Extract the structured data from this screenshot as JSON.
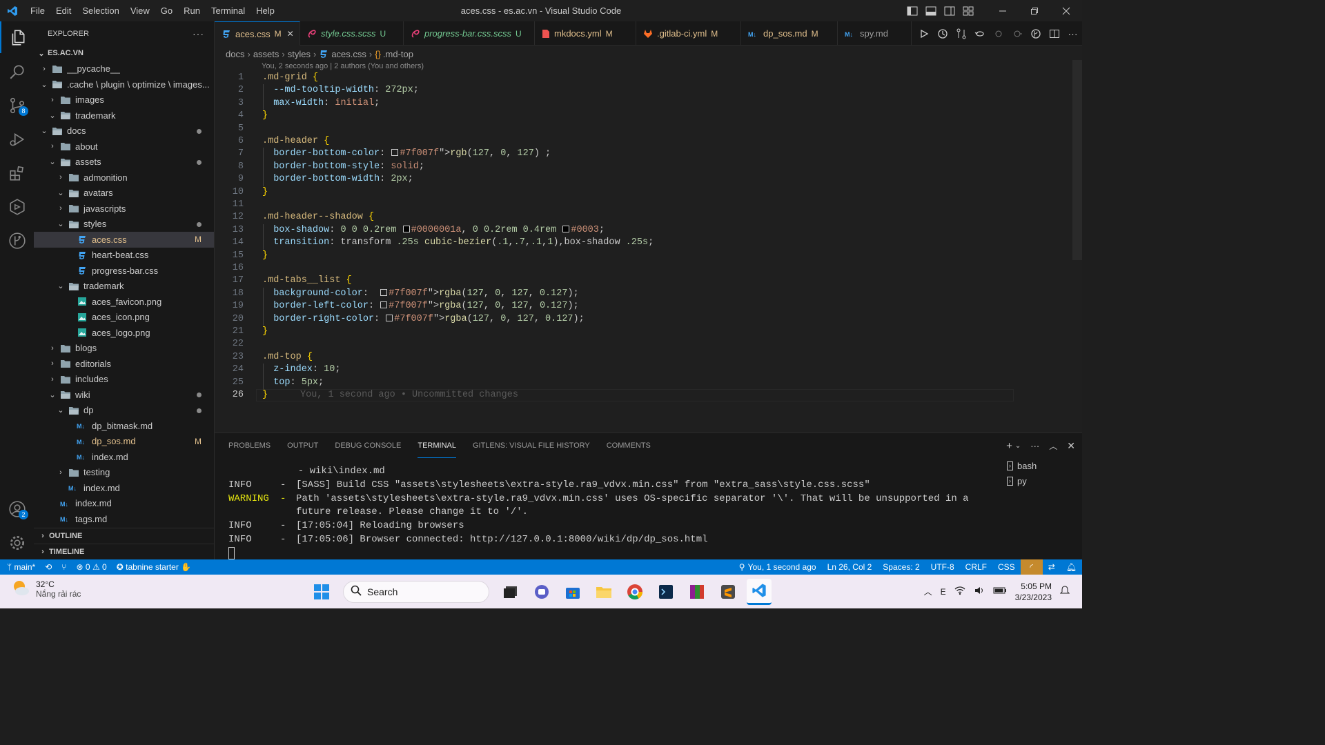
{
  "window": {
    "title": "aces.css - es.ac.vn - Visual Studio Code"
  },
  "menu": [
    "File",
    "Edit",
    "Selection",
    "View",
    "Go",
    "Run",
    "Terminal",
    "Help"
  ],
  "activity_bar": {
    "source_control_badge": "8",
    "accounts_badge": "2"
  },
  "explorer": {
    "header": "EXPLORER",
    "root": "ES.AC.VN",
    "tree": [
      {
        "label": "__pycache__",
        "depth": 1,
        "type": "folder",
        "open": false,
        "status": ""
      },
      {
        "label": ".cache \\ plugin \\ optimize \\ images...",
        "depth": 1,
        "type": "folder",
        "open": true,
        "status": ""
      },
      {
        "label": "images",
        "depth": 2,
        "type": "folder",
        "open": false,
        "status": ""
      },
      {
        "label": "trademark",
        "depth": 2,
        "type": "folder",
        "open": true,
        "status": ""
      },
      {
        "label": "docs",
        "depth": 1,
        "type": "folder",
        "open": true,
        "status": "dot"
      },
      {
        "label": "about",
        "depth": 2,
        "type": "folder",
        "open": false,
        "status": ""
      },
      {
        "label": "assets",
        "depth": 2,
        "type": "folder",
        "open": true,
        "status": "dot"
      },
      {
        "label": "admonition",
        "depth": 3,
        "type": "folder",
        "open": false,
        "status": ""
      },
      {
        "label": "avatars",
        "depth": 3,
        "type": "folder",
        "open": true,
        "status": ""
      },
      {
        "label": "javascripts",
        "depth": 3,
        "type": "folder",
        "open": false,
        "status": ""
      },
      {
        "label": "styles",
        "depth": 3,
        "type": "folder",
        "open": true,
        "status": "dot"
      },
      {
        "label": "aces.css",
        "depth": 4,
        "type": "css",
        "open": false,
        "status": "M",
        "selected": true
      },
      {
        "label": "heart-beat.css",
        "depth": 4,
        "type": "css",
        "open": false,
        "status": ""
      },
      {
        "label": "progress-bar.css",
        "depth": 4,
        "type": "css",
        "open": false,
        "status": ""
      },
      {
        "label": "trademark",
        "depth": 3,
        "type": "folder",
        "open": true,
        "status": ""
      },
      {
        "label": "aces_favicon.png",
        "depth": 4,
        "type": "png",
        "open": false,
        "status": ""
      },
      {
        "label": "aces_icon.png",
        "depth": 4,
        "type": "png",
        "open": false,
        "status": ""
      },
      {
        "label": "aces_logo.png",
        "depth": 4,
        "type": "png",
        "open": false,
        "status": ""
      },
      {
        "label": "blogs",
        "depth": 2,
        "type": "folder",
        "open": false,
        "status": ""
      },
      {
        "label": "editorials",
        "depth": 2,
        "type": "folder",
        "open": false,
        "status": ""
      },
      {
        "label": "includes",
        "depth": 2,
        "type": "folder",
        "open": false,
        "status": ""
      },
      {
        "label": "wiki",
        "depth": 2,
        "type": "folder",
        "open": true,
        "status": "dot"
      },
      {
        "label": "dp",
        "depth": 3,
        "type": "folder",
        "open": true,
        "status": "dot"
      },
      {
        "label": "dp_bitmask.md",
        "depth": 4,
        "type": "md",
        "open": false,
        "status": ""
      },
      {
        "label": "dp_sos.md",
        "depth": 4,
        "type": "md",
        "open": false,
        "status": "M"
      },
      {
        "label": "index.md",
        "depth": 4,
        "type": "md",
        "open": false,
        "status": ""
      },
      {
        "label": "testing",
        "depth": 3,
        "type": "folder",
        "open": false,
        "status": ""
      },
      {
        "label": "index.md",
        "depth": 3,
        "type": "md",
        "open": false,
        "status": ""
      },
      {
        "label": "index.md",
        "depth": 2,
        "type": "md",
        "open": false,
        "status": ""
      },
      {
        "label": "tags.md",
        "depth": 2,
        "type": "md",
        "open": false,
        "status": ""
      }
    ],
    "outline": "OUTLINE",
    "timeline": "TIMELINE"
  },
  "tabs": [
    {
      "label": "aces.css",
      "status": "M",
      "type": "css",
      "active": true
    },
    {
      "label": "style.css.scss",
      "status": "U",
      "type": "scss"
    },
    {
      "label": "progress-bar.css.scss",
      "status": "U",
      "type": "scss"
    },
    {
      "label": "mkdocs.yml",
      "status": "M",
      "type": "yml"
    },
    {
      "label": ".gitlab-ci.yml",
      "status": "M",
      "type": "gitlab"
    },
    {
      "label": "dp_sos.md",
      "status": "M",
      "type": "md"
    },
    {
      "label": "spy.md",
      "status": "",
      "type": "md"
    }
  ],
  "breadcrumb": [
    "docs",
    "assets",
    "styles",
    "aces.css",
    ".md-top"
  ],
  "blame_header": "You, 2 seconds ago | 2 authors (You and others)",
  "code_lines": [
    ".md-grid {",
    "  --md-tooltip-width: 272px;",
    "  max-width: initial;",
    "}",
    "",
    ".md-header {",
    "  border-bottom-color: rgb(127, 0, 127) ;",
    "  border-bottom-style: solid;",
    "  border-bottom-width: 2px;",
    "}",
    "",
    ".md-header--shadow {",
    "  box-shadow: 0 0 0.2rem #0000001a, 0 0.2rem 0.4rem #0003;",
    "  transition: transform .25s cubic-bezier(.1,.7,.1,1),box-shadow .25s;",
    "}",
    "",
    ".md-tabs__list {",
    "  background-color:  rgba(127, 0, 127, 0.127);",
    "  border-left-color: rgba(127, 0, 127, 0.127);",
    "  border-right-color: rgba(127, 0, 127, 0.127);",
    "}",
    "",
    ".md-top {",
    "  z-index: 10;",
    "  top: 5px;",
    "}"
  ],
  "current_line": 26,
  "inline_blame": "You, 1 second ago • Uncommitted changes",
  "panel": {
    "tabs": [
      "PROBLEMS",
      "OUTPUT",
      "DEBUG CONSOLE",
      "TERMINAL",
      "GITLENS: VISUAL FILE HISTORY",
      "COMMENTS"
    ],
    "active_tab": "TERMINAL",
    "terminal_lines": [
      {
        "level": "",
        "sep": "",
        "text": "       - wiki\\index.md"
      },
      {
        "level": "INFO",
        "sep": "-",
        "text": "[SASS] Build CSS \"assets\\stylesheets\\extra-style.ra9_vdvx.min.css\" from \"extra_sass\\style.css.scss\""
      },
      {
        "level": "WARNING",
        "sep": "-",
        "text": "Path 'assets\\stylesheets\\extra-style.ra9_vdvx.min.css' uses OS-specific separator '\\'. That will be unsupported in a"
      },
      {
        "level": "",
        "sep": "",
        "text": "future release. Please change it to '/'."
      },
      {
        "level": "INFO",
        "sep": "-",
        "text": "[17:05:04] Reloading browsers"
      },
      {
        "level": "INFO",
        "sep": "-",
        "text": "[17:05:06] Browser connected: http://127.0.0.1:8000/wiki/dp/dp_sos.html"
      }
    ],
    "terminals": [
      "bash",
      "py"
    ]
  },
  "statusbar": {
    "branch": "main*",
    "errors": "0",
    "warnings": "0",
    "tabnine": "tabnine starter",
    "blame": "You, 1 second ago",
    "cursor": "Ln 26, Col 2",
    "spaces": "Spaces: 2",
    "encoding": "UTF-8",
    "eol": "CRLF",
    "language": "CSS"
  },
  "taskbar": {
    "weather_temp": "32°C",
    "weather_desc": "Nắng rải rác",
    "search": "Search",
    "time": "5:05 PM",
    "date": "3/23/2023"
  },
  "colors": {
    "accent": "#0078d4",
    "modified": "#e2c08d",
    "untracked": "#73c991",
    "swatch": "#7f007f"
  }
}
